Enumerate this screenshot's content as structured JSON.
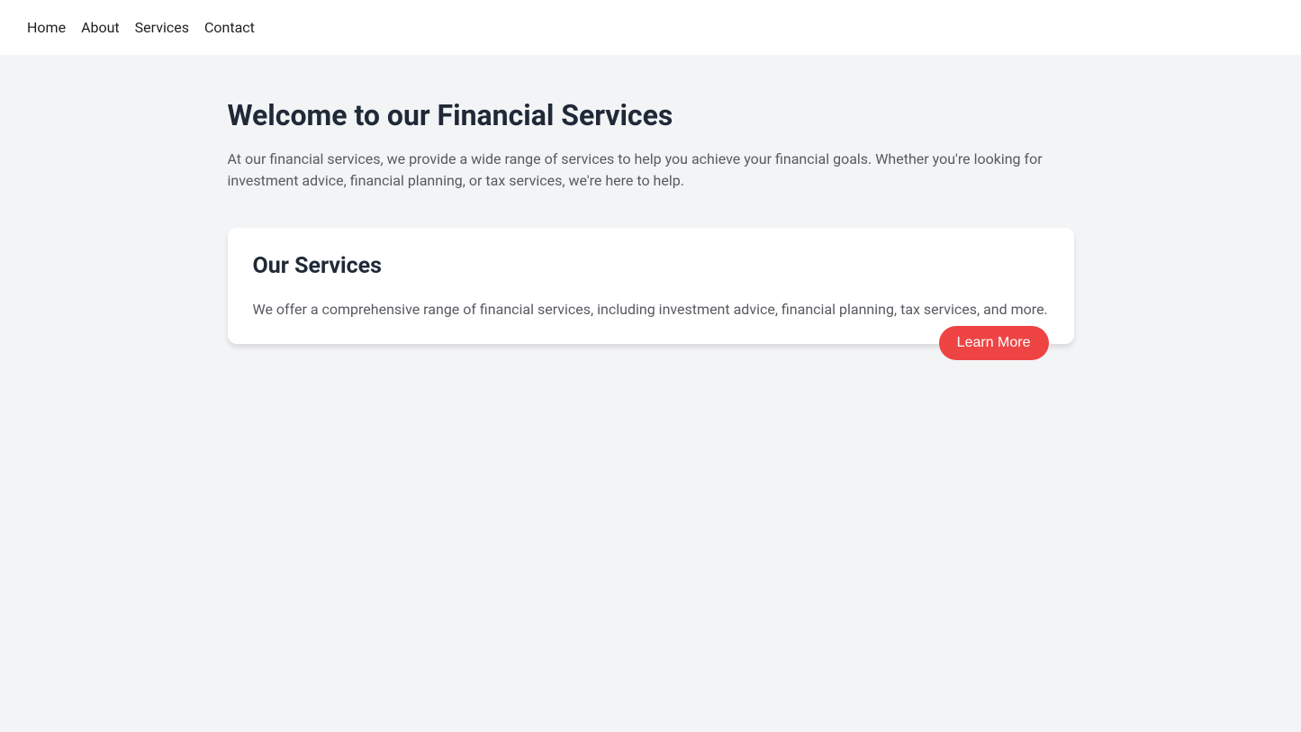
{
  "nav": {
    "items": [
      {
        "label": "Home"
      },
      {
        "label": "About"
      },
      {
        "label": "Services"
      },
      {
        "label": "Contact"
      }
    ]
  },
  "hero": {
    "title": "Welcome to our Financial Services",
    "description": "At our financial services, we provide a wide range of services to help you achieve your financial goals. Whether you're looking for investment advice, financial planning, or tax services, we're here to help."
  },
  "card": {
    "title": "Our Services",
    "description": "We offer a comprehensive range of financial services, including investment advice, financial planning, tax services, and more.",
    "cta_label": "Learn More"
  }
}
